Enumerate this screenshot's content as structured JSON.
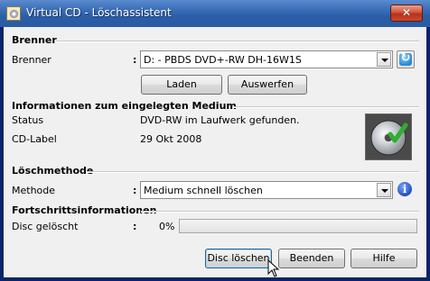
{
  "window": {
    "title": "Virtual CD - Löschassistent",
    "close_label": "✕"
  },
  "burner_section": {
    "title": "Brenner",
    "label": "Brenner",
    "colon": ":",
    "selected": "D: - PBDS DVD+-RW DH-16W1S",
    "refresh_icon": "refresh-icon",
    "load_button": "Laden",
    "eject_button": "Auswerfen"
  },
  "media_section": {
    "title": "Informationen zum eingelegten Medium",
    "status_label": "Status",
    "status_value": "DVD-RW im Laufwerk gefunden.",
    "cdlabel_label": "CD-Label",
    "cdlabel_value": "29 Okt 2008",
    "disc_icon": "disc-check-icon"
  },
  "method_section": {
    "title": "Löschmethode",
    "label": "Methode",
    "colon": ":",
    "selected": "Medium schnell löschen",
    "info_icon": "info-icon",
    "info_glyph": "i"
  },
  "progress_section": {
    "title": "Fortschrittsinformationen",
    "label": "Disc gelöscht",
    "colon": ":",
    "percent_text": "0%",
    "progress_fraction": 0.0
  },
  "footer": {
    "erase_button": "Disc löschen",
    "quit_button": "Beenden",
    "help_button": "Hilfe"
  },
  "colors": {
    "title_bar": "#2b5ea8",
    "client_bg": "#f0f0f0",
    "close_button": "#c9482c",
    "progress_fill": "#4cbe3c"
  }
}
